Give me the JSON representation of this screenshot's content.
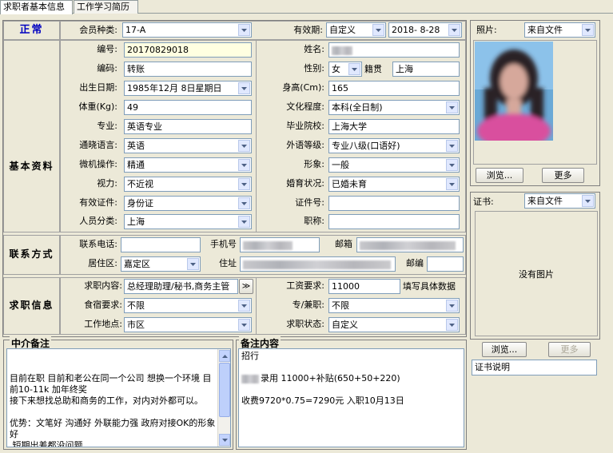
{
  "tabs": [
    "求职者基本信息",
    "工作学习简历"
  ],
  "header": {
    "status": "正常",
    "member_type_label": "会员种类:",
    "member_type": "17-A",
    "validity_label": "有效期:",
    "validity_mode": "自定义",
    "validity_date": "2018- 8-28"
  },
  "sections": {
    "basic": "基本资料",
    "contact": "联系方式",
    "job": "求职信息"
  },
  "basic": {
    "id_label": "编号:",
    "id_value": "20170829018",
    "name_label": "姓名:",
    "code_label": "编码:",
    "code_value": "转账",
    "gender_label": "性别:",
    "gender_value": "女",
    "native_label": "籍贯",
    "native_value": "上海",
    "birth_label": "出生日期:",
    "birth_value": "1985年12月 8日星期日",
    "height_label": "身高(Cm):",
    "height_value": "165",
    "weight_label": "体重(Kg):",
    "weight_value": "49",
    "edu_label": "文化程度:",
    "edu_value": "本科(全日制)",
    "major_label": "专业:",
    "major_value": "英语专业",
    "school_label": "毕业院校:",
    "school_value": "上海大学",
    "lang_label": "通晓语言:",
    "lang_value": "英语",
    "foreign_label": "外语等级:",
    "foreign_value": "专业八级(口语好)",
    "pc_label": "微机操作:",
    "pc_value": "精通",
    "image_label": "形象:",
    "image_value": "一般",
    "vision_label": "视力:",
    "vision_value": "不近视",
    "marital_label": "婚育状况:",
    "marital_value": "已婚未育",
    "cert_label": "有效证件:",
    "cert_value": "身份证",
    "certno_label": "证件号:",
    "category_label": "人员分类:",
    "category_value": "上海",
    "title_label": "职称:"
  },
  "contact": {
    "phone_label": "联系电话:",
    "mobile_label": "手机号",
    "email_label": "邮箱",
    "district_label": "居住区:",
    "district_value": "嘉定区",
    "address_label": "住址",
    "postcode_label": "邮编"
  },
  "job": {
    "intent_label": "求职内容:",
    "intent_value": "总经理助理/秘书,商务主管",
    "more_btn": "≫",
    "salary_label": "工资要求:",
    "salary_value": "11000",
    "salary_hint": "填写具体数据",
    "board_label": "食宿要求:",
    "board_value": "不限",
    "fulltime_label": "专/兼职:",
    "fulltime_value": "不限",
    "location_label": "工作地点:",
    "location_value": "市区",
    "state_label": "求职状态:",
    "state_value": "自定义"
  },
  "notes": {
    "agent_title": "中介备注",
    "agent_text": "目前在职 目前和老公在同一个公司 想换一个环境 目前10-11k 加年终奖\n接下来想找总助和商务的工作，对内对外都可以。\n\n优势：文笔好 沟通好 外联能力强 政府对接OK的形象好\n 短期出差都没问题",
    "remark_title": "备注内容",
    "remark_line1": "招行",
    "remark_line2": "录用  11000+补贴(650+50+220)",
    "remark_line3": "收费9720*0.75=7290元 入职10月13日"
  },
  "photo": {
    "label": "照片:",
    "source": "来自文件",
    "browse": "浏览...",
    "more": "更多"
  },
  "certificate": {
    "label": "证书:",
    "source": "来自文件",
    "no_image": "没有图片",
    "browse": "浏览...",
    "more": "更多",
    "desc": "证书说明"
  }
}
